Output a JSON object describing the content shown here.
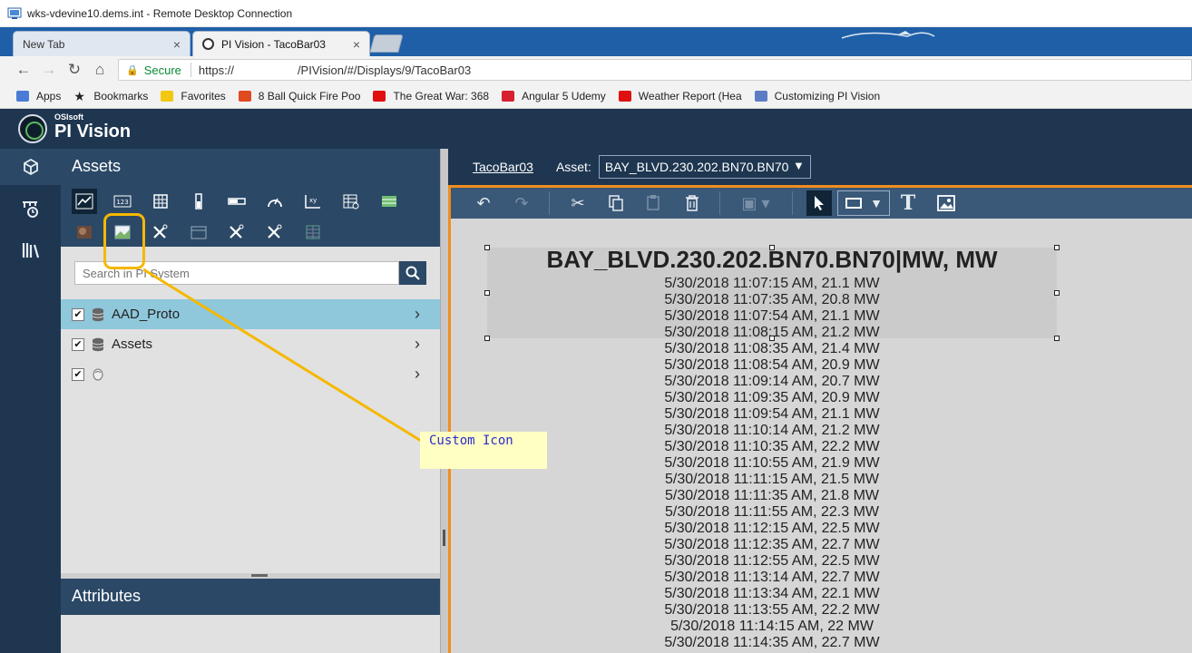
{
  "window": {
    "title": "wks-vdevine10.dems.int - Remote Desktop Connection"
  },
  "browser": {
    "tabs": [
      {
        "label": "New Tab"
      },
      {
        "label": "PI Vision - TacoBar03"
      }
    ],
    "tab_close": "×",
    "address": {
      "secure_label": "Secure",
      "url_prefix": "https://",
      "url_path": "/PIVision/#/Displays/9/TacoBar03"
    },
    "bookmarks": [
      {
        "label": "Apps",
        "color": "#4a7bd6"
      },
      {
        "label": "Bookmarks",
        "color": "#222222"
      },
      {
        "label": "Favorites",
        "color": "#f2c811"
      },
      {
        "label": "8 Ball Quick Fire Poo",
        "color": "#e04a1f"
      },
      {
        "label": "The Great War: 368",
        "color": "#e01010"
      },
      {
        "label": "Angular 5 Udemy",
        "color": "#d61f2f"
      },
      {
        "label": "Weather Report (Hea",
        "color": "#e01010"
      },
      {
        "label": "Customizing PI Vision",
        "color": "#5c7cc4"
      }
    ]
  },
  "app": {
    "brand_small": "OSIsoft",
    "brand": "PI Vision",
    "assets_title": "Assets",
    "search_placeholder": "Search in PI System",
    "tree": [
      {
        "label": "AAD_Proto",
        "selected": true
      },
      {
        "label": "Assets",
        "selected": false
      },
      {
        "label": "",
        "selected": false
      }
    ],
    "attributes_title": "Attributes",
    "display_name": "TacoBar03",
    "asset_label": "Asset:",
    "asset_value": "BAY_BLVD.230.202.BN70.BN70"
  },
  "display": {
    "value_title": "BAY_BLVD.230.202.BN70.BN70|MW, MW",
    "values": [
      "5/30/2018 11:07:15 AM, 21.1 MW",
      "5/30/2018 11:07:35 AM, 20.8 MW",
      "5/30/2018 11:07:54 AM, 21.1 MW",
      "5/30/2018 11:08:15 AM, 21.2 MW",
      "5/30/2018 11:08:35 AM, 21.4 MW",
      "5/30/2018 11:08:54 AM, 20.9 MW",
      "5/30/2018 11:09:14 AM, 20.7 MW",
      "5/30/2018 11:09:35 AM, 20.9 MW",
      "5/30/2018 11:09:54 AM, 21.1 MW",
      "5/30/2018 11:10:14 AM, 21.2 MW",
      "5/30/2018 11:10:35 AM, 22.2 MW",
      "5/30/2018 11:10:55 AM, 21.9 MW",
      "5/30/2018 11:11:15 AM, 21.5 MW",
      "5/30/2018 11:11:35 AM, 21.8 MW",
      "5/30/2018 11:11:55 AM, 22.3 MW",
      "5/30/2018 11:12:15 AM, 22.5 MW",
      "5/30/2018 11:12:35 AM, 22.7 MW",
      "5/30/2018 11:12:55 AM, 22.5 MW",
      "5/30/2018 11:13:14 AM, 22.7 MW",
      "5/30/2018 11:13:34 AM, 22.1 MW",
      "5/30/2018 11:13:55 AM, 22.2 MW",
      "5/30/2018 11:14:15 AM, 22 MW",
      "5/30/2018 11:14:35 AM, 22.7 MW"
    ]
  },
  "annotation": {
    "callout_text": "Custom Icon"
  },
  "colors": {
    "header": "#1e3650",
    "pane": "#2b4866",
    "accent": "#f28c1f",
    "selected_row": "#8fc7db",
    "annotation": "#f5b800"
  }
}
